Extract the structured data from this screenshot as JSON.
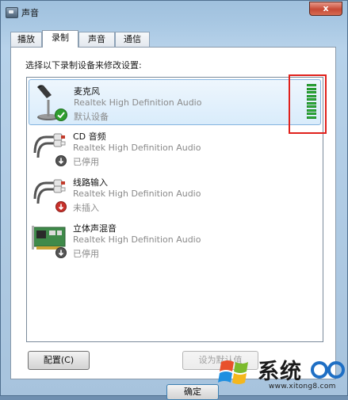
{
  "window": {
    "title": "声音",
    "close_glyph": "x"
  },
  "tabs": [
    {
      "label": "播放",
      "active": false
    },
    {
      "label": "录制",
      "active": true
    },
    {
      "label": "声音",
      "active": false
    },
    {
      "label": "通信",
      "active": false
    }
  ],
  "instruction": "选择以下录制设备来修改设置:",
  "devices": [
    {
      "name": "麦克风",
      "driver": "Realtek High Definition Audio",
      "status": "默认设备",
      "icon": "microphone-icon",
      "badge": "green-check-badge",
      "selected": true
    },
    {
      "name": "CD 音频",
      "driver": "Realtek High Definition Audio",
      "status": "已停用",
      "icon": "audio-cable-icon",
      "badge": "down-arrow-badge",
      "selected": false
    },
    {
      "name": "线路输入",
      "driver": "Realtek High Definition Audio",
      "status": "未插入",
      "icon": "audio-cable-icon",
      "badge": "red-down-arrow-badge",
      "selected": false
    },
    {
      "name": "立体声混音",
      "driver": "Realtek High Definition Audio",
      "status": "已停用",
      "icon": "sound-card-icon",
      "badge": "down-arrow-badge",
      "selected": false
    }
  ],
  "buttons": {
    "configure": "配置(C)",
    "set_default": "设为默认值",
    "ok": "确定"
  },
  "watermark": {
    "text": "系统",
    "url": "www.xitong8.com"
  },
  "colors": {
    "meter_green": "#2fb53a",
    "highlight_red": "#e0211c",
    "selection_blue": "#84b4e0"
  }
}
